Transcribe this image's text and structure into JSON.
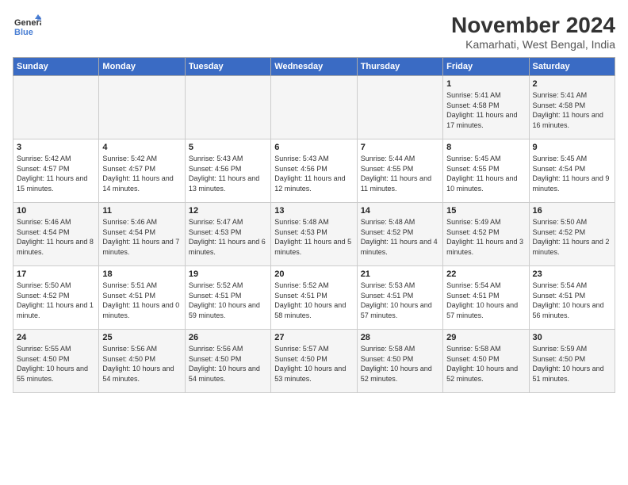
{
  "header": {
    "logo_line1": "General",
    "logo_line2": "Blue",
    "month": "November 2024",
    "location": "Kamarhati, West Bengal, India"
  },
  "weekdays": [
    "Sunday",
    "Monday",
    "Tuesday",
    "Wednesday",
    "Thursday",
    "Friday",
    "Saturday"
  ],
  "weeks": [
    [
      {
        "day": "",
        "text": ""
      },
      {
        "day": "",
        "text": ""
      },
      {
        "day": "",
        "text": ""
      },
      {
        "day": "",
        "text": ""
      },
      {
        "day": "",
        "text": ""
      },
      {
        "day": "1",
        "text": "Sunrise: 5:41 AM\nSunset: 4:58 PM\nDaylight: 11 hours and 17 minutes."
      },
      {
        "day": "2",
        "text": "Sunrise: 5:41 AM\nSunset: 4:58 PM\nDaylight: 11 hours and 16 minutes."
      }
    ],
    [
      {
        "day": "3",
        "text": "Sunrise: 5:42 AM\nSunset: 4:57 PM\nDaylight: 11 hours and 15 minutes."
      },
      {
        "day": "4",
        "text": "Sunrise: 5:42 AM\nSunset: 4:57 PM\nDaylight: 11 hours and 14 minutes."
      },
      {
        "day": "5",
        "text": "Sunrise: 5:43 AM\nSunset: 4:56 PM\nDaylight: 11 hours and 13 minutes."
      },
      {
        "day": "6",
        "text": "Sunrise: 5:43 AM\nSunset: 4:56 PM\nDaylight: 11 hours and 12 minutes."
      },
      {
        "day": "7",
        "text": "Sunrise: 5:44 AM\nSunset: 4:55 PM\nDaylight: 11 hours and 11 minutes."
      },
      {
        "day": "8",
        "text": "Sunrise: 5:45 AM\nSunset: 4:55 PM\nDaylight: 11 hours and 10 minutes."
      },
      {
        "day": "9",
        "text": "Sunrise: 5:45 AM\nSunset: 4:54 PM\nDaylight: 11 hours and 9 minutes."
      }
    ],
    [
      {
        "day": "10",
        "text": "Sunrise: 5:46 AM\nSunset: 4:54 PM\nDaylight: 11 hours and 8 minutes."
      },
      {
        "day": "11",
        "text": "Sunrise: 5:46 AM\nSunset: 4:54 PM\nDaylight: 11 hours and 7 minutes."
      },
      {
        "day": "12",
        "text": "Sunrise: 5:47 AM\nSunset: 4:53 PM\nDaylight: 11 hours and 6 minutes."
      },
      {
        "day": "13",
        "text": "Sunrise: 5:48 AM\nSunset: 4:53 PM\nDaylight: 11 hours and 5 minutes."
      },
      {
        "day": "14",
        "text": "Sunrise: 5:48 AM\nSunset: 4:52 PM\nDaylight: 11 hours and 4 minutes."
      },
      {
        "day": "15",
        "text": "Sunrise: 5:49 AM\nSunset: 4:52 PM\nDaylight: 11 hours and 3 minutes."
      },
      {
        "day": "16",
        "text": "Sunrise: 5:50 AM\nSunset: 4:52 PM\nDaylight: 11 hours and 2 minutes."
      }
    ],
    [
      {
        "day": "17",
        "text": "Sunrise: 5:50 AM\nSunset: 4:52 PM\nDaylight: 11 hours and 1 minute."
      },
      {
        "day": "18",
        "text": "Sunrise: 5:51 AM\nSunset: 4:51 PM\nDaylight: 11 hours and 0 minutes."
      },
      {
        "day": "19",
        "text": "Sunrise: 5:52 AM\nSunset: 4:51 PM\nDaylight: 10 hours and 59 minutes."
      },
      {
        "day": "20",
        "text": "Sunrise: 5:52 AM\nSunset: 4:51 PM\nDaylight: 10 hours and 58 minutes."
      },
      {
        "day": "21",
        "text": "Sunrise: 5:53 AM\nSunset: 4:51 PM\nDaylight: 10 hours and 57 minutes."
      },
      {
        "day": "22",
        "text": "Sunrise: 5:54 AM\nSunset: 4:51 PM\nDaylight: 10 hours and 57 minutes."
      },
      {
        "day": "23",
        "text": "Sunrise: 5:54 AM\nSunset: 4:51 PM\nDaylight: 10 hours and 56 minutes."
      }
    ],
    [
      {
        "day": "24",
        "text": "Sunrise: 5:55 AM\nSunset: 4:50 PM\nDaylight: 10 hours and 55 minutes."
      },
      {
        "day": "25",
        "text": "Sunrise: 5:56 AM\nSunset: 4:50 PM\nDaylight: 10 hours and 54 minutes."
      },
      {
        "day": "26",
        "text": "Sunrise: 5:56 AM\nSunset: 4:50 PM\nDaylight: 10 hours and 54 minutes."
      },
      {
        "day": "27",
        "text": "Sunrise: 5:57 AM\nSunset: 4:50 PM\nDaylight: 10 hours and 53 minutes."
      },
      {
        "day": "28",
        "text": "Sunrise: 5:58 AM\nSunset: 4:50 PM\nDaylight: 10 hours and 52 minutes."
      },
      {
        "day": "29",
        "text": "Sunrise: 5:58 AM\nSunset: 4:50 PM\nDaylight: 10 hours and 52 minutes."
      },
      {
        "day": "30",
        "text": "Sunrise: 5:59 AM\nSunset: 4:50 PM\nDaylight: 10 hours and 51 minutes."
      }
    ]
  ]
}
